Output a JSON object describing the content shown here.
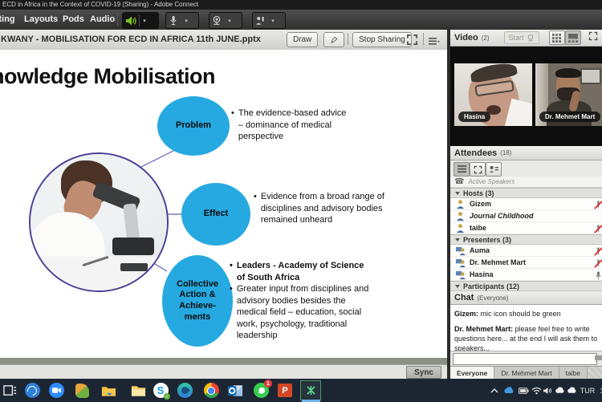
{
  "window": {
    "title": "ECD in Africa in the Context of COVID-19 (Sharing) - Adobe Connect"
  },
  "menubar": {
    "meeting": "Meeting",
    "layouts": "Layouts",
    "pods": "Pods",
    "audio": "Audio"
  },
  "share_pod": {
    "filename": "KWANY  - MOBILISATION FOR ECD IN AFRICA  11th JUNE.pptx",
    "draw_label": "Draw",
    "stop_sharing_label": "Stop Sharing",
    "sync_label": "Sync"
  },
  "slide": {
    "title": "Knowledge Mobilisation",
    "nodes": [
      {
        "label": "Problem"
      },
      {
        "label": "Effect"
      },
      {
        "label": "Collective Action  & Achieve- ments"
      }
    ],
    "bullets": {
      "problem": "The evidence-based advice – dominance of medical perspective",
      "effect": "Evidence from a broad range of disciplines and  advisory bodies remained unheard",
      "collective_bold": "Leaders - Academy of Science of South Africa",
      "collective_text": "Greater input from disciplines and advisory bodies besides the medical field – education, social work, psychology, traditional leadership"
    },
    "accent_color": "#26a9e0"
  },
  "video_pod": {
    "title": "Video",
    "count": "(2)",
    "start_label": "Start",
    "videos": [
      {
        "name": "Hasina"
      },
      {
        "name": "Dr. Mehmet Mart"
      }
    ]
  },
  "attendees_pod": {
    "title": "Attendees",
    "count": "(18)",
    "active_speakers_label": "Active Speakers",
    "hosts_header": "Hosts (3)",
    "presenters_header": "Presenters (3)",
    "participants_header": "Participants (12)",
    "hosts": [
      {
        "name": "Gizem"
      },
      {
        "name": "Journal Childhood"
      },
      {
        "name": "taibe"
      }
    ],
    "presenters": [
      {
        "name": "Auma"
      },
      {
        "name": "Dr. Mehmet Mart"
      },
      {
        "name": "Hasina"
      }
    ]
  },
  "chat_pod": {
    "title": "Chat",
    "scope": "(Everyone)",
    "messages": [
      {
        "author": "Gizem:",
        "text": "mic icon should be green"
      },
      {
        "author": "Dr. Mehmet Mart:",
        "text": "please feel free to write questions here... at the end I will ask them to speakers..."
      }
    ],
    "tabs": [
      {
        "label": "Everyone"
      },
      {
        "label": "Dr. Mehmet Mart"
      },
      {
        "label": "taibe"
      }
    ]
  },
  "taskbar": {
    "language": "TUR",
    "whatsapp_badge": "1",
    "clock_partial": "1"
  }
}
